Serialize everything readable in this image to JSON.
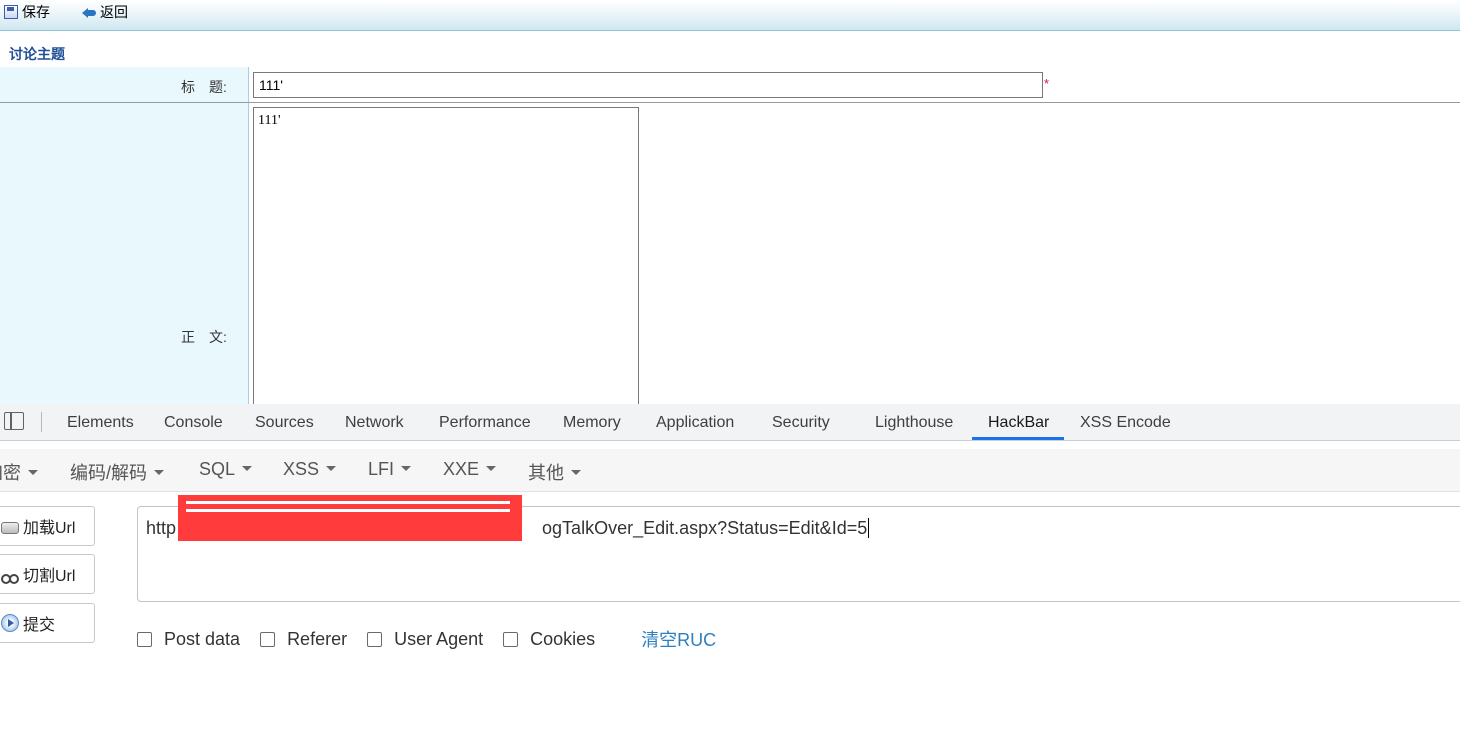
{
  "toolbar": {
    "save_label": "保存",
    "back_label": "返回"
  },
  "form": {
    "section_title": "讨论主题",
    "title_label": "标　题:",
    "title_value": "111'",
    "required_mark": "*",
    "body_label": "正　文:",
    "body_value": "111'"
  },
  "devtools": {
    "tabs": [
      "Elements",
      "Console",
      "Sources",
      "Network",
      "Performance",
      "Memory",
      "Application",
      "Security",
      "Lighthouse",
      "HackBar",
      "XSS Encode"
    ],
    "active_tab": "HackBar",
    "hackbar": {
      "menu": [
        "加密",
        "编码/解码",
        "SQL",
        "XSS",
        "LFI",
        "XXE",
        "其他"
      ],
      "buttons": {
        "load_url": "加载Url",
        "split_url": "切割Url",
        "submit": "提交"
      },
      "url_prefix": "http",
      "url_suffix": "ogTalkOver_Edit.aspx?Status=Edit&Id=5",
      "options": [
        "Post data",
        "Referer",
        "User Agent",
        "Cookies"
      ],
      "clear_label": "清空RUC"
    }
  },
  "colors": {
    "accent": "#1a73e8",
    "redaction": "#ff3b3b",
    "link": "#2d7fc0",
    "form_label_bg": "#e9f8fd"
  }
}
